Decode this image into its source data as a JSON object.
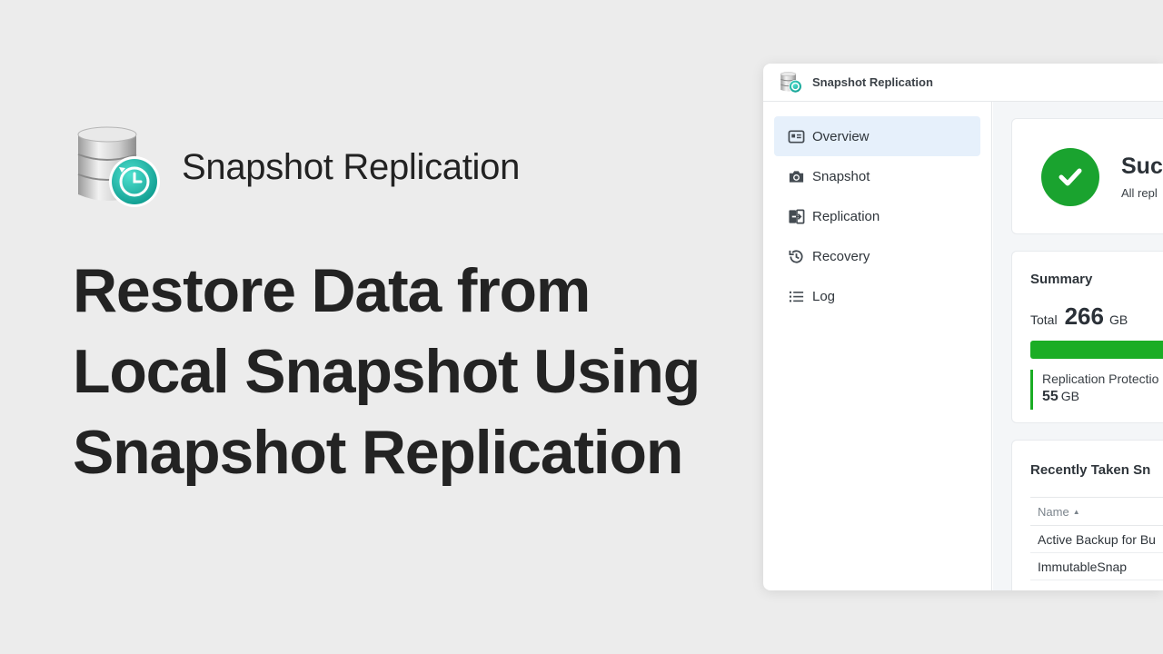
{
  "hero": {
    "app_name": "Snapshot Replication",
    "headline": "Restore Data from\nLocal Snapshot Using\nSnapshot Replication",
    "logo_icon": "snapshot-replication-logo-icon"
  },
  "window": {
    "title": "Snapshot Replication",
    "icon": "snapshot-replication-logo-icon"
  },
  "sidebar": {
    "items": [
      {
        "label": "Overview",
        "icon": "overview-icon",
        "active": true
      },
      {
        "label": "Snapshot",
        "icon": "camera-icon",
        "active": false
      },
      {
        "label": "Replication",
        "icon": "replication-icon",
        "active": false
      },
      {
        "label": "Recovery",
        "icon": "history-icon",
        "active": false
      },
      {
        "label": "Log",
        "icon": "list-icon",
        "active": false
      }
    ]
  },
  "status": {
    "title": "Suc",
    "subtitle": "All repl",
    "icon": "check-circle-icon",
    "color": "#1aa32f"
  },
  "summary": {
    "title": "Summary",
    "total_label": "Total",
    "total_value": "266",
    "total_unit": "GB",
    "bar_color": "#1bad25",
    "bar_fill_fraction": 1.0,
    "legend": {
      "label": "Replication Protectio",
      "value": "55",
      "unit": "GB"
    }
  },
  "recent": {
    "title": "Recently Taken Sn",
    "column_header": "Name",
    "rows": [
      "Active Backup for Bu",
      "ImmutableSnap"
    ]
  }
}
